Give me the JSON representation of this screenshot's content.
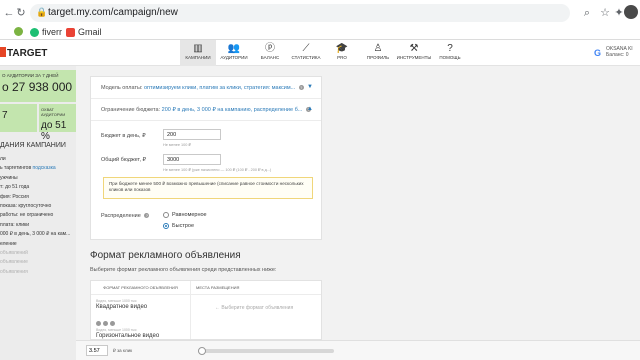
{
  "browser": {
    "url": "target.my.com/campaign/new",
    "bookmarks": [
      {
        "label": "",
        "icon": "globe-icon",
        "color": "#7cb342"
      },
      {
        "label": "fiverr",
        "icon": "fiverr-icon",
        "color": "#1dbf73"
      },
      {
        "label": "Gmail",
        "icon": "gmail-icon",
        "color": "#ea4335"
      }
    ]
  },
  "header": {
    "logo": "TARGET",
    "nav": [
      {
        "label": "КАМПАНИИ",
        "icon": "campaigns-icon",
        "active": true
      },
      {
        "label": "АУДИТОРИИ",
        "icon": "audiences-icon",
        "active": false
      },
      {
        "label": "БАЛАНС",
        "icon": "balance-icon",
        "active": false
      },
      {
        "label": "СТАТИСТИКА",
        "icon": "statistics-icon",
        "active": false
      },
      {
        "label": "PRO",
        "icon": "pro-icon",
        "active": false
      },
      {
        "label": "ПРОФИЛЬ",
        "icon": "profile-icon",
        "active": false
      },
      {
        "label": "ИНСТРУМЕНТЫ",
        "icon": "tools-icon",
        "active": false
      },
      {
        "label": "ПОМОЩЬ",
        "icon": "help-icon",
        "active": false
      }
    ],
    "account": {
      "line1": "OKSANA KI",
      "line2": "Баланс: 0"
    }
  },
  "sidebar": {
    "audience_label": "О АУДИТОРИИ ЗА 7 ДНЕЙ",
    "audience_value": "о 27 938 000",
    "cell1_label": "",
    "cell1_value": "7",
    "cell2_label": "ОХВАТ АУДИТОРИИ",
    "cell2_value": "до 51 %",
    "section_title": "ДАНИЯ КАМПАНИИ",
    "lines": [
      {
        "text": "ли",
        "link": "",
        "muted": false
      },
      {
        "text": "ь таргетингов ",
        "link": "подсказка",
        "muted": false
      },
      {
        "text": "ужчины",
        "link": "",
        "muted": false
      },
      {
        "text": "т: до 51 года",
        "link": "",
        "muted": false
      },
      {
        "text": "фия: Россия",
        "link": "",
        "muted": false
      },
      {
        "text": "показа: круглосуточно",
        "link": "",
        "muted": false
      },
      {
        "text": "работы: не ограничено",
        "link": "",
        "muted": false
      },
      {
        "text": "плата: клики",
        "link": "",
        "muted": false
      },
      {
        "text": "000 ₽ в день, 3 000 ₽ на кам...",
        "link": "",
        "muted": false
      },
      {
        "text": "еление",
        "link": "",
        "muted": false
      },
      {
        "text": "объявлений",
        "link": "",
        "muted": true
      },
      {
        "text": "объявление",
        "link": "",
        "muted": true
      },
      {
        "text": "объявления",
        "link": "",
        "muted": true
      }
    ]
  },
  "form": {
    "payment_label": "Модель оплаты:",
    "payment_value": "оптимизируем клики, платим за клики, стратегия: максим...",
    "budget_label": "Ограничение бюджета:",
    "budget_value": "200 ₽ в день, 3 000 ₽ на кампанию, распределение б...",
    "daily_label": "Бюджет в день, ₽",
    "daily_value": "200",
    "daily_hint": "Не менее 100 ₽",
    "total_label": "Общий бюджет, ₽",
    "total_value": "3000",
    "total_hint": "Не менее 100 ₽ (уже начислено — 100 ₽ (100 ₽ - 200 ₽ в д...)",
    "notice": "При бюджете менее 500 ₽ возможно превышение (списание равное стоимости нескольких кликов или показов",
    "distribution_label": "Распределение",
    "options": [
      {
        "label": "Равномерное",
        "selected": false
      },
      {
        "label": "Быстрое",
        "selected": true
      }
    ]
  },
  "format": {
    "title": "Формат рекламного объявления",
    "subtitle": "Выберите формат рекламного объявления среди представленных ниже:",
    "col_format": "ФОРМАТ РЕКЛАМНОГО ОБЪЯВЛЕНИЯ",
    "col_places": "МЕСТА РАЗМЕЩЕНИЯ",
    "tiny1": "Видео, меньше 1000 тыс",
    "item1": "Квадратное видео",
    "tiny2": "Видео, меньше 1000 тыс",
    "item2": "Горизонтальное видео",
    "placeholder": "← Выберите формат объявления"
  },
  "bottom": {
    "bid_value": "3.57",
    "bid_unit": "₽ за клик",
    "slider_fraction": 0.03
  }
}
